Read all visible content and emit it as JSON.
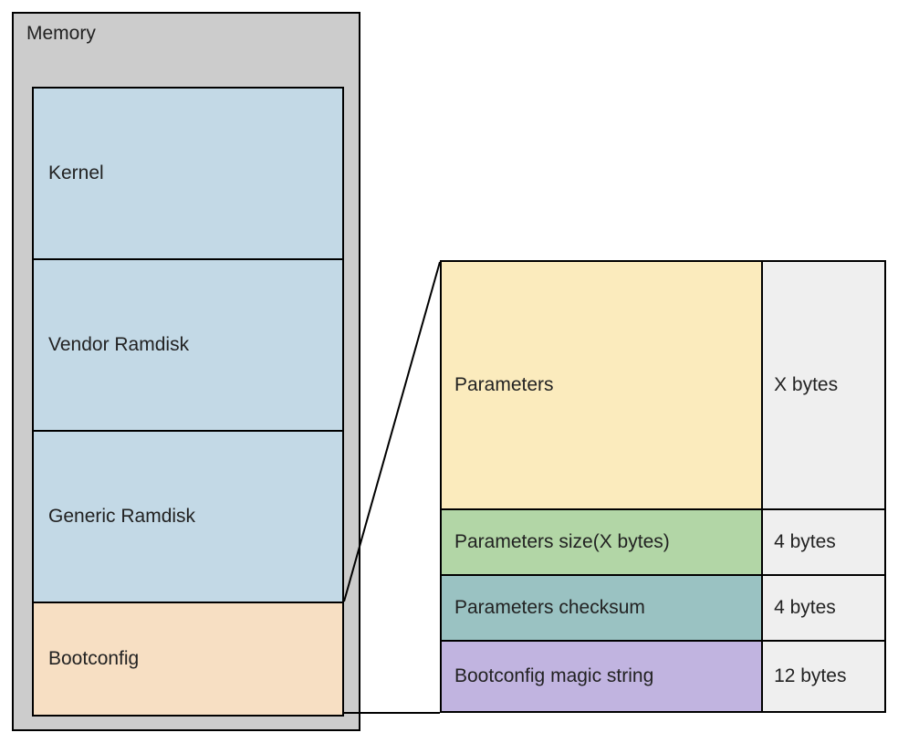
{
  "memory": {
    "title": "Memory",
    "segments": [
      {
        "label": "Kernel"
      },
      {
        "label": "Vendor Ramdisk"
      },
      {
        "label": "Generic Ramdisk"
      },
      {
        "label": "Bootconfig"
      }
    ]
  },
  "bootconfig_detail": {
    "rows": [
      {
        "label": "Parameters",
        "size": "X bytes"
      },
      {
        "label": "Parameters size(X bytes)",
        "size": "4 bytes"
      },
      {
        "label": "Parameters checksum",
        "size": "4 bytes"
      },
      {
        "label": "Bootconfig magic string",
        "size": "12 bytes"
      }
    ]
  },
  "colors": {
    "memory_bg": "#cccccc",
    "segment_blue": "#c3d9e6",
    "segment_orange": "#f7dfc3",
    "detail_yellow": "#fbebbd",
    "detail_green": "#b2d6a6",
    "detail_teal": "#9ac2c2",
    "detail_purple": "#c1b4e0",
    "size_bg": "#efefef"
  }
}
